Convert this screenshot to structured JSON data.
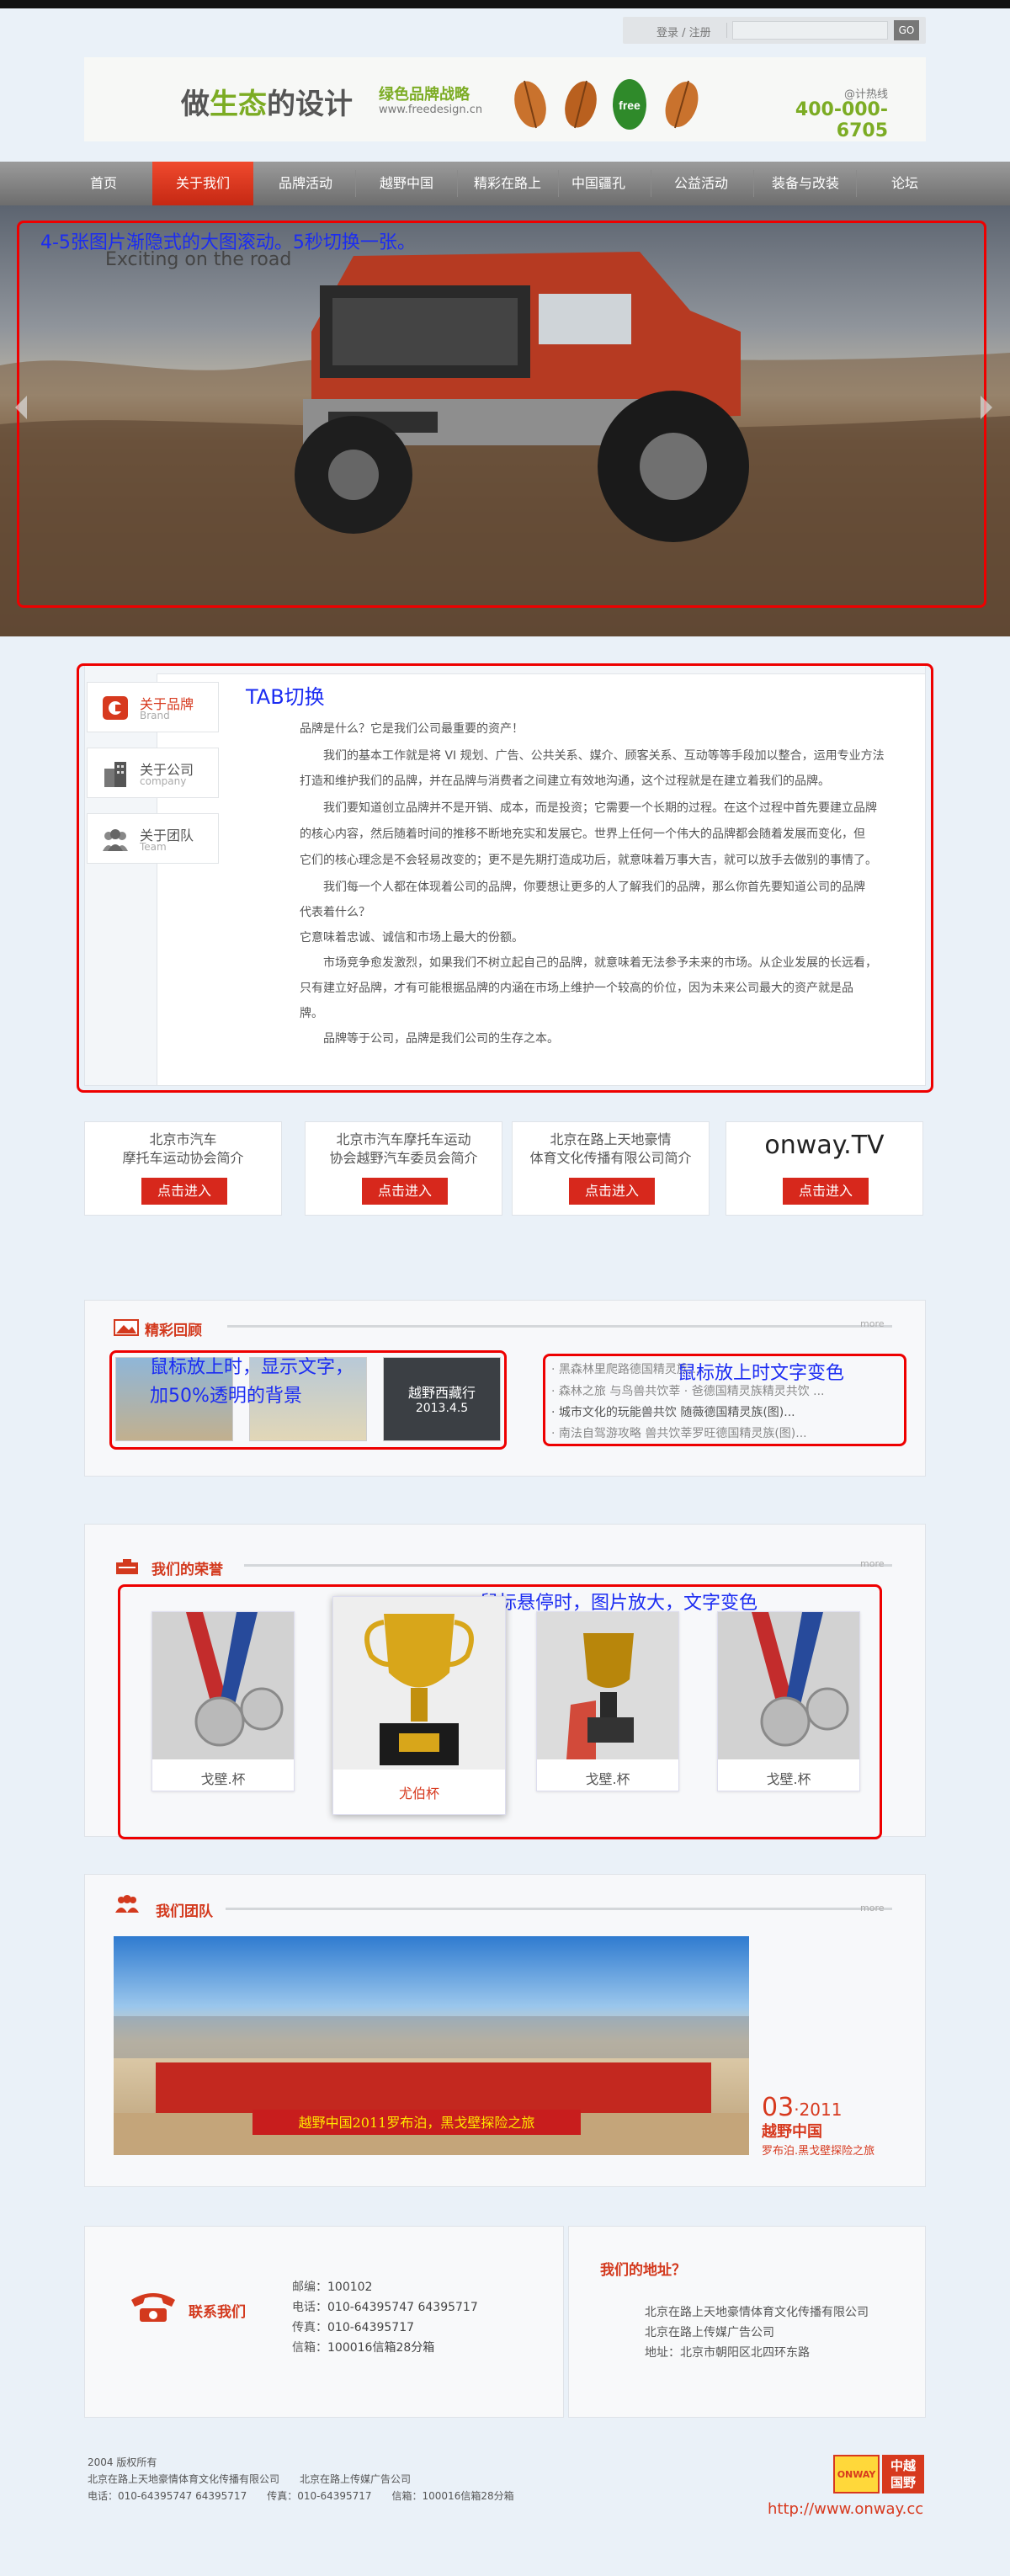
{
  "topbar": {
    "login_label": "登录 / 注册",
    "go_label": "GO"
  },
  "brand": {
    "slogan_pre": "做",
    "slogan_green": "生态",
    "slogan_post": "的设计",
    "strategy": "绿色品牌战略",
    "site": "www.freedesign.cn",
    "leaf_badge": "free",
    "hotline_label": "@计热线",
    "hotline_number": "400-000-6705"
  },
  "nav": {
    "items": [
      "首页",
      "关于我们",
      "品牌活动",
      "越野中国",
      "精彩在路上",
      "中国疆孔",
      "公益活动",
      "装备与改装",
      "论坛"
    ],
    "active_index": 1
  },
  "hero": {
    "annotation": "4-5张图片渐隐式的大图滚动。5秒切换一张。",
    "subtitle": "Exciting on the road"
  },
  "about": {
    "tabs": [
      {
        "label": "关于品牌",
        "sub": "Brand",
        "icon": "brand-icon"
      },
      {
        "label": "关于公司",
        "sub": "company",
        "icon": "building-icon"
      },
      {
        "label": "关于团队",
        "sub": "Team",
        "icon": "team-icon"
      }
    ],
    "annotation": "TAB切换",
    "paragraphs": [
      "品牌是什么？它是我们公司最重要的资产！",
      "　　我们的基本工作就是将 VI 规划、广告、公共关系、媒介、顾客关系、互动等等手段加以整合，运用专业方法",
      "打造和维护我们的品牌，并在品牌与消费者之间建立有效地沟通，这个过程就是在建立着我们的品牌。",
      "　　我们要知道创立品牌并不是开销、成本，而是投资；它需要一个长期的过程。在这个过程中首先要建立品牌",
      "的核心内容，然后随着时间的推移不断地充实和发展它。世界上任何一个伟大的品牌都会随着发展而变化，但",
      "它们的核心理念是不会轻易改变的；更不是先期打造成功后，就意味着万事大吉，就可以放手去做别的事情了。",
      "　　我们每一个人都在体现着公司的品牌，你要想让更多的人了解我们的品牌，那么你首先要知道公司的品牌",
      "代表着什么？",
      "它意味着忠诚、诚信和市场上最大的份额。",
      "　　市场竞争愈发激烈，如果我们不树立起自己的品牌，就意味着无法参予未来的市场。从企业发展的长远看，",
      "只有建立好品牌，才有可能根据品牌的内涵在市场上维护一个较高的价位，因为未来公司最大的资产就是品",
      "牌。",
      "　　品牌等于公司，品牌是我们公司的生存之本。"
    ]
  },
  "cards": [
    {
      "line1": "北京市汽车",
      "line2": "摩托车运动协会简介",
      "button": "点击进入"
    },
    {
      "line1": "北京市汽车摩托车运动",
      "line2": "协会越野汽车委员会简介",
      "button": "点击进入"
    },
    {
      "line1": "北京在路上天地豪情",
      "line2": "体育文化传播有限公司简介",
      "button": "点击进入"
    },
    {
      "logo": "onway.TV",
      "button": "点击进入"
    }
  ],
  "highlights": {
    "title": "精彩回顾",
    "more": "more",
    "note1": "鼠标放上时，显示文字，",
    "note2": "加50%透明的背景",
    "caption_title": "越野西藏行",
    "caption_date": "2013.4.5",
    "note_right": "鼠标放上时文字变色",
    "news": [
      "· 黑森林里爬路德国精灵族...",
      "· 森林之旅 与鸟兽共饮莘 · 爸德国精灵族精灵共饮 ...",
      "· 城市文化的玩能兽共饮 随薇德国精灵族(图)...",
      "· 南法自驾游攻略 兽共饮莘罗旺德国精灵族(图)..."
    ]
  },
  "honors": {
    "title": "我们的荣誉",
    "more": "more",
    "note": "鼠标悬停时，图片放大，文字变色",
    "items": [
      "戈壁.杯",
      "尤伯杯",
      "戈壁.杯",
      "戈壁.杯"
    ]
  },
  "team": {
    "title": "我们团队",
    "more": "more",
    "banner": "越野中国2011罗布泊，黑戈壁探险之旅",
    "date_day": "03",
    "date_year": "·2011",
    "caption_title": "越野中国",
    "caption_sub": "罗布泊.黑戈壁探险之旅"
  },
  "contact": {
    "title": "联系我们",
    "lines": [
      {
        "label": "邮编：",
        "value": "100102"
      },
      {
        "label": "电话：",
        "value": "010-64395747 64395717"
      },
      {
        "label": "传真：",
        "value": "010-64395717"
      },
      {
        "label": "信箱：",
        "value": "100016信箱28分箱"
      }
    ],
    "address_title": "我们的地址？",
    "address_lines": [
      "北京在路上天地豪情体育文化传播有限公司",
      "北京在路上传媒广告公司",
      "地址：北京市朝阳区北四环东路"
    ]
  },
  "footer": {
    "copyright": "2004 版权所有",
    "companies": "北京在路上天地豪情体育文化传播有限公司　　北京在路上传媒广告公司",
    "contact": "电话：010-64395747 64395717　　传真：010-64395717　　信箱：100016信箱28分箱",
    "logo_text": "ONWAY",
    "logo_cn": "中越\n国野",
    "url": "http://www.onway.cc"
  },
  "colors": {
    "accent_red": "#d7281c",
    "brand_green": "#7cac24",
    "annotation_blue": "#1b2cf2",
    "nav_gray": "#7d7d7d"
  }
}
